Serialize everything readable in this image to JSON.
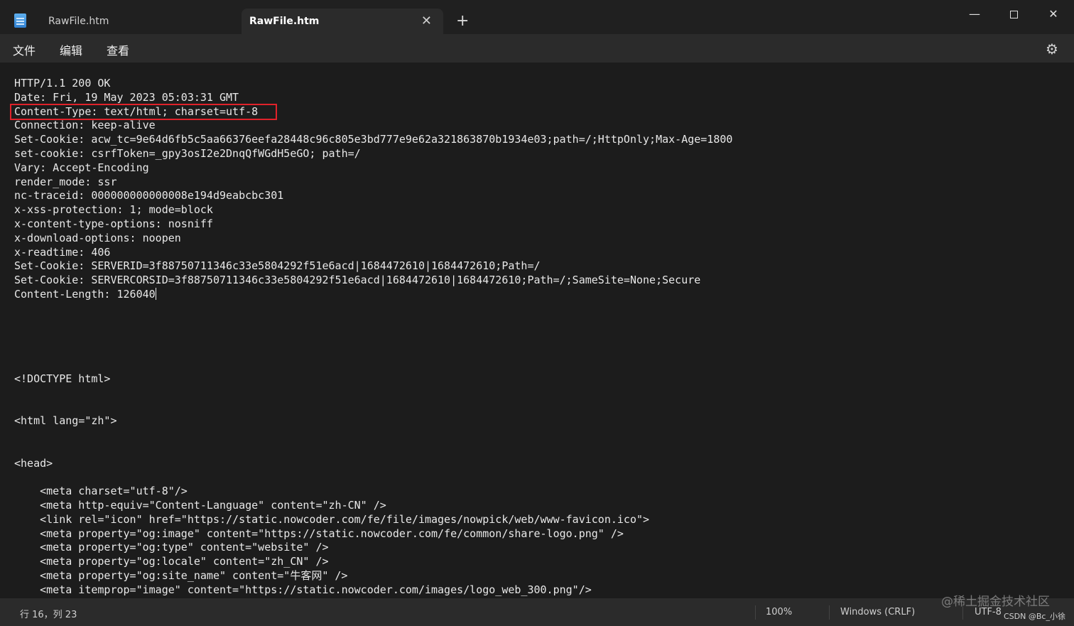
{
  "tabs": [
    {
      "title": "RawFile.htm",
      "active": false
    },
    {
      "title": "RawFile.htm",
      "active": true
    }
  ],
  "window": {
    "minimize": "—",
    "close": "✕",
    "tab_add": "+",
    "tab_close": "✕"
  },
  "menu": {
    "file": "文件",
    "edit": "编辑",
    "view": "查看",
    "settings_icon": "gear-icon"
  },
  "editor": {
    "lines": [
      "HTTP/1.1 200 OK",
      "Date: Fri, 19 May 2023 05:03:31 GMT",
      "Content-Type: text/html; charset=utf-8",
      "Connection: keep-alive",
      "Set-Cookie: acw_tc=9e64d6fb5c5aa66376eefa28448c96c805e3bd777e9e62a321863870b1934e03;path=/;HttpOnly;Max-Age=1800",
      "set-cookie: csrfToken=_gpy3osI2e2DnqQfWGdH5eGO; path=/",
      "Vary: Accept-Encoding",
      "render_mode: ssr",
      "nc-traceid: 000000000000008e194d9eabcbc301",
      "x-xss-protection: 1; mode=block",
      "x-content-type-options: nosniff",
      "x-download-options: noopen",
      "x-readtime: 406",
      "Set-Cookie: SERVERID=3f88750711346c33e5804292f51e6acd|1684472610|1684472610;Path=/",
      "Set-Cookie: SERVERCORSID=3f88750711346c33e5804292f51e6acd|1684472610|1684472610;Path=/;SameSite=None;Secure",
      "Content-Length: 126040",
      "",
      "",
      "",
      "",
      "",
      "<!DOCTYPE html>",
      "",
      "",
      "<html lang=\"zh\">",
      "",
      "",
      "<head>",
      "",
      "    <meta charset=\"utf-8\"/>",
      "    <meta http-equiv=\"Content-Language\" content=\"zh-CN\" />",
      "    <link rel=\"icon\" href=\"https://static.nowcoder.com/fe/file/images/nowpick/web/www-favicon.ico\">",
      "    <meta property=\"og:image\" content=\"https://static.nowcoder.com/fe/common/share-logo.png\" />",
      "    <meta property=\"og:type\" content=\"website\" />",
      "    <meta property=\"og:locale\" content=\"zh_CN\" />",
      "    <meta property=\"og:site_name\" content=\"牛客网\" />",
      "    <meta itemprop=\"image\" content=\"https://static.nowcoder.com/images/logo_web_300.png\"/>"
    ],
    "highlighted_line": 2,
    "caret_line": 15
  },
  "status": {
    "position": "行 16，列 23",
    "zoom": "100%",
    "line_ending": "Windows (CRLF)",
    "encoding": "UTF-8"
  },
  "watermark": {
    "main": "@稀土掘金技术社区",
    "small": "CSDN @Bc_小徐"
  },
  "colors": {
    "highlight_border": "#e0222a",
    "editor_bg": "#1c1c1c"
  }
}
